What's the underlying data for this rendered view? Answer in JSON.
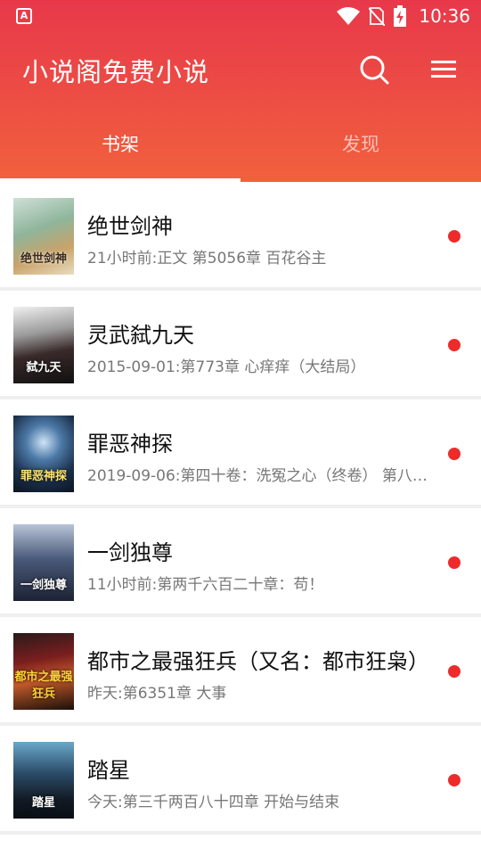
{
  "status_bar": {
    "time": "10:36",
    "app_icon_letter": "A"
  },
  "header": {
    "title": "小说阁免费小说",
    "icons": [
      "search-icon",
      "menu-icon"
    ]
  },
  "tabs": [
    {
      "label": "书架",
      "active": true
    },
    {
      "label": "发现",
      "active": false
    }
  ],
  "colors": {
    "header_top": "#e8384a",
    "header_bottom": "#f1613d",
    "update_dot": "#ee2b2b"
  },
  "books": [
    {
      "title": "绝世剑神",
      "subtitle": "21小时前:正文 第5056章 百花谷主",
      "cover_text": "绝世剑神",
      "has_update": true
    },
    {
      "title": "灵武弑九天",
      "subtitle": "2015-09-01:第773章 心痒痒（大结局）",
      "cover_text": "弑九天",
      "has_update": true
    },
    {
      "title": "罪恶神探",
      "subtitle": "2019-09-06:第四十卷：洗冤之心（终卷） 第八…",
      "cover_text": "罪恶神探",
      "has_update": true
    },
    {
      "title": "一剑独尊",
      "subtitle": "11小时前:第两千六百二十章：苟！",
      "cover_text": "一剑独尊",
      "has_update": true
    },
    {
      "title": "都市之最强狂兵（又名：都市狂枭）",
      "subtitle": "昨天:第6351章 大事",
      "cover_text": "都市之最强狂兵",
      "has_update": true
    },
    {
      "title": "踏星",
      "subtitle": "今天:第三千两百八十四章 开始与结束",
      "cover_text": "踏星",
      "has_update": true
    }
  ]
}
